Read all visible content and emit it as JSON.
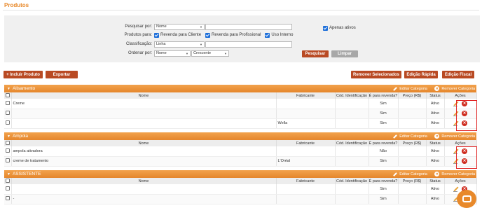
{
  "page": {
    "title": "Produtos"
  },
  "filter": {
    "search_label": "Pesquisar por:",
    "search_field": "Nome",
    "search_value": "",
    "only_active": "Apenas ativos",
    "products_for_label": "Produtos para:",
    "opt_client": "Revenda para Cliente",
    "opt_professional": "Revenda para Profissional",
    "opt_internal": "Uso Interno",
    "classification_label": "Classificação:",
    "classification_value": "Linha",
    "classification_text": "",
    "order_label": "Ordenar por:",
    "order_field": "Nome",
    "order_dir": "Crescente",
    "search_button": "Pesquisar",
    "clear_button": "Limpar"
  },
  "actions": {
    "add_product": "+ Incluir Produto",
    "export": "Exportar",
    "remove_selected": "Remover Selecionados",
    "quick_edit": "Edição Rápida",
    "tax_edit": "Edição Fiscal"
  },
  "category_actions": {
    "edit": "Editar Categoria",
    "remove": "Remover Categoria"
  },
  "columns": [
    "Nome",
    "Fabricante",
    "Cód. Identificação",
    "É para revenda?",
    "Preço (R$)",
    "Status",
    "Ações"
  ],
  "categories": [
    {
      "name": "Alisamento",
      "rows": [
        {
          "name": "Creme",
          "maker": "",
          "code": "",
          "resale": "Sim",
          "price": "",
          "status": "Ativo"
        },
        {
          "name": "",
          "maker": "",
          "code": "",
          "resale": "Sim",
          "price": "",
          "status": "Ativo"
        },
        {
          "name": "",
          "maker": "Wella",
          "code": "",
          "resale": "Sim",
          "price": "",
          "status": "Ativo"
        }
      ]
    },
    {
      "name": "Ampola",
      "rows": [
        {
          "name": "ampola ativadora",
          "maker": "",
          "code": "",
          "resale": "Não",
          "price": "",
          "status": "Ativo"
        },
        {
          "name": "creme de tratamento",
          "maker": "L'Oréal",
          "code": "",
          "resale": "Sim",
          "price": "",
          "status": "Ativo"
        }
      ]
    },
    {
      "name": "ASSISTENTE",
      "rows": [
        {
          "name": "",
          "maker": "",
          "code": "",
          "resale": "Sim",
          "price": "",
          "status": "Ativo"
        },
        {
          "name": "-",
          "maker": "",
          "code": "",
          "resale": "Sim",
          "price": "",
          "status": "Ativo"
        }
      ]
    }
  ],
  "colors": {
    "accent": "#e8892a",
    "button": "#b94a23",
    "highlight": "#e02424"
  },
  "icons": [
    "edit-icon",
    "delete-icon",
    "chat-icon"
  ]
}
